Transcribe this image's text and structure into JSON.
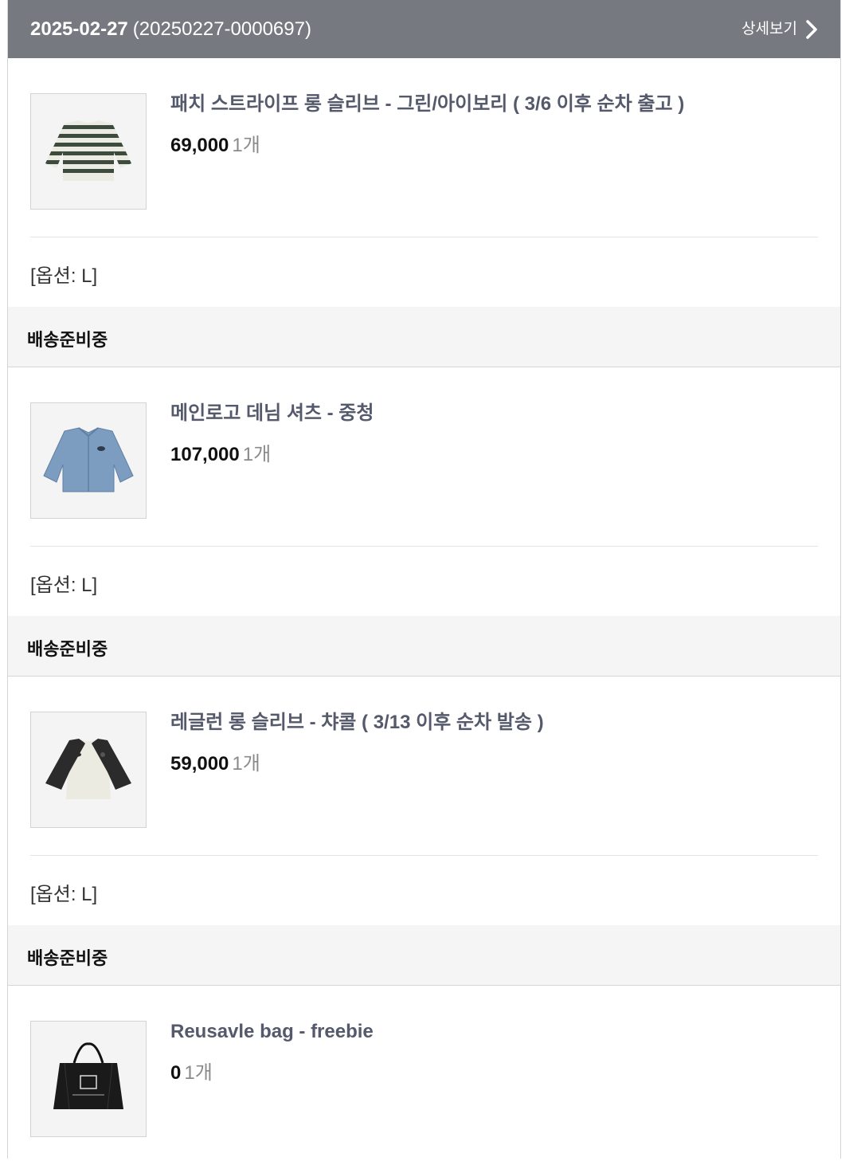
{
  "order": {
    "date": "2025-02-27",
    "number": "(20250227-0000697)",
    "detail_label": "상세보기"
  },
  "items": [
    {
      "name": "패치 스트라이프 롱 슬리브 - 그린/아이보리 ( 3/6 이후 순차 출고 )",
      "price": "69,000",
      "qty": "1개",
      "option": "[옵션: L]",
      "status": "배송준비중",
      "icon": "striped-long-sleeve-icon"
    },
    {
      "name": "메인로고 데님 셔츠 - 중청",
      "price": "107,000",
      "qty": "1개",
      "option": "[옵션: L]",
      "status": "배송준비중",
      "icon": "denim-shirt-icon"
    },
    {
      "name": "레글런 롱 슬리브 - 챠콜 ( 3/13 이후 순차 발송 )",
      "price": "59,000",
      "qty": "1개",
      "option": "[옵션: L]",
      "status": "배송준비중",
      "icon": "raglan-long-sleeve-icon"
    },
    {
      "name": "Reusavle bag - freebie",
      "price": "0",
      "qty": "1개",
      "icon": "tote-bag-icon"
    }
  ]
}
